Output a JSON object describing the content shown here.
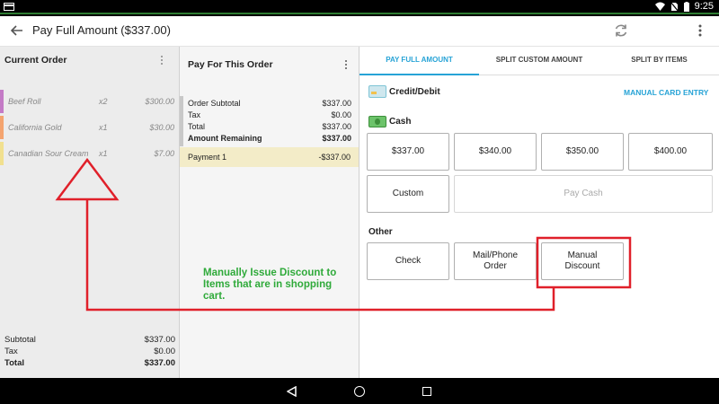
{
  "status_bar": {
    "time": "9:25"
  },
  "toolbar": {
    "title": "Pay Full Amount ($337.00)"
  },
  "current_order": {
    "title": "Current Order",
    "items": [
      {
        "name": "Beef Roll",
        "qty": "x2",
        "price": "$300.00",
        "color": "#c47bc6"
      },
      {
        "name": "California Gold",
        "qty": "x1",
        "price": "$30.00",
        "color": "#f4a46f"
      },
      {
        "name": "Canadian Sour Cream",
        "qty": "x1",
        "price": "$7.00",
        "color": "#f1e08f"
      }
    ],
    "summary": [
      {
        "label": "Subtotal",
        "value": "$337.00"
      },
      {
        "label": "Tax",
        "value": "$0.00"
      },
      {
        "label": "Total",
        "value": "$337.00"
      }
    ]
  },
  "pay_for_order": {
    "title": "Pay For This Order",
    "rows": [
      {
        "label": "Order Subtotal",
        "value": "$337.00"
      },
      {
        "label": "Tax",
        "value": "$0.00"
      },
      {
        "label": "Total",
        "value": "$337.00"
      },
      {
        "label": "Amount Remaining",
        "value": "$337.00"
      }
    ],
    "payment": {
      "label": "Payment 1",
      "value": "-$337.00"
    }
  },
  "tabs": [
    {
      "label": "PAY FULL AMOUNT",
      "active": true
    },
    {
      "label": "SPLIT CUSTOM AMOUNT",
      "active": false
    },
    {
      "label": "SPLIT BY ITEMS",
      "active": false
    }
  ],
  "payment_methods": {
    "credit_label": "Credit/Debit",
    "manual_entry": "MANUAL CARD ENTRY",
    "cash_label": "Cash",
    "cash_amounts": [
      "$337.00",
      "$340.00",
      "$350.00",
      "$400.00"
    ],
    "custom": "Custom",
    "pay_cash": "Pay Cash",
    "other_label": "Other",
    "check": "Check",
    "mail_phone": "Mail/Phone Order",
    "manual_discount": "Manual Discount"
  },
  "annotation": {
    "text": "Manually Issue Discount to Items that are in shopping cart.",
    "color": "#e0202a"
  },
  "colors": {
    "accent": "#27a3d6",
    "status_line": "#2e7d32",
    "annotation_text": "#2faa3a"
  }
}
